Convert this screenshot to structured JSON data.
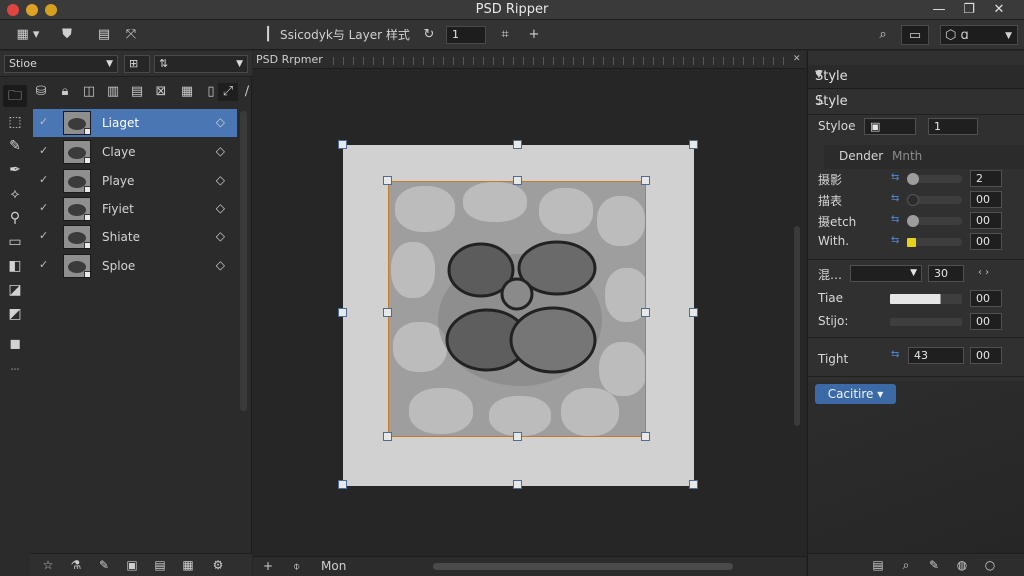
{
  "window": {
    "title": "PSD Ripper"
  },
  "options_bar": {
    "tool_label": "Ssicodyk与 Layer 样式",
    "value_field": "1"
  },
  "left_dock": {
    "dropdown_label": "Stioe",
    "layers": [
      {
        "name": "Liaget",
        "selected": true
      },
      {
        "name": "Claye",
        "selected": false
      },
      {
        "name": "Playe",
        "selected": false
      },
      {
        "name": "Fiyiet",
        "selected": false
      },
      {
        "name": "Shiate",
        "selected": false
      },
      {
        "name": "Sploe",
        "selected": false
      }
    ]
  },
  "canvas": {
    "doc_tab": "PSD Rrpmer",
    "bottom_label": "Mon"
  },
  "right_dock": {
    "tab": "Style",
    "header": "Style",
    "style_row": {
      "label": "Styloe",
      "value": "1"
    },
    "sub_tab": {
      "active": "Dender",
      "inactive": "Mnth"
    },
    "rows": [
      {
        "label": "摄影",
        "value": "2",
        "knob_color": "#9d9d9d"
      },
      {
        "label": "描表",
        "value": "00",
        "knob_color": "#9d9d9d"
      },
      {
        "label": "摄etch",
        "value": "00",
        "knob_color": "#9d9d9d"
      },
      {
        "label": "With.",
        "value": "00",
        "knob_color": "#e6d21a"
      }
    ],
    "blend": {
      "label": "混…",
      "value": "30"
    },
    "rows2": [
      {
        "label": "Tiae",
        "value": "00"
      },
      {
        "label": "Stijo:",
        "value": "00"
      }
    ],
    "tight": {
      "label": "Tight",
      "value": "43",
      "value2": "00"
    },
    "button": "Cacitire"
  },
  "colors": {
    "accent": "#4a77b3",
    "selection_orange": "#c27b2a",
    "traffic_red": "#e0443e",
    "traffic_yellow": "#dea123"
  }
}
